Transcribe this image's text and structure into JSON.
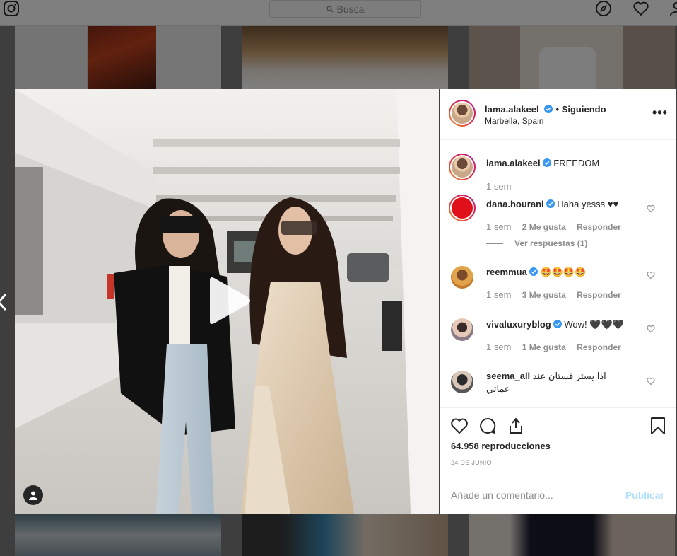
{
  "search": {
    "placeholder": "Busca"
  },
  "post": {
    "username": "lama.alakeel",
    "follow_status": "• Siguiendo",
    "location": "Marbella, Spain",
    "caption": "FREEDOM",
    "caption_time": "1 sem",
    "views": "64.958 reproducciones",
    "date": "24 DE JUNIO"
  },
  "comments": [
    {
      "username": "dana.hourani",
      "text": "Haha yesss ♥♥",
      "time": "1 sem",
      "likes": "2 Me gusta",
      "reply": "Responder"
    },
    {
      "username": "reemmua",
      "text": "🤩🤩🤩🤩",
      "time": "1 sem",
      "likes": "3 Me gusta",
      "reply": "Responder"
    },
    {
      "username": "vivaluxuryblog",
      "text": "Wow! 🖤🖤🖤",
      "time": "1 sem",
      "likes": "1 Me gusta",
      "reply": "Responder"
    },
    {
      "username": "seema_all",
      "text": "اذا يستر فستان عند عماتي"
    }
  ],
  "view_replies": "Ver respuestas (1)",
  "add_comment": {
    "placeholder": "Añade un comentario...",
    "publish": "Publicar"
  },
  "icons": {
    "logo": "instagram-icon",
    "explore": "compass-icon",
    "activity": "heart-icon",
    "profile": "person-icon",
    "play": "play-icon",
    "like": "heart-icon",
    "comment": "comment-icon",
    "share": "share-icon",
    "save": "bookmark-icon"
  },
  "colors": {
    "verified": "#3897f0",
    "publish_disabled": "#b2dffc",
    "dana_avatar": "#e0101a"
  }
}
